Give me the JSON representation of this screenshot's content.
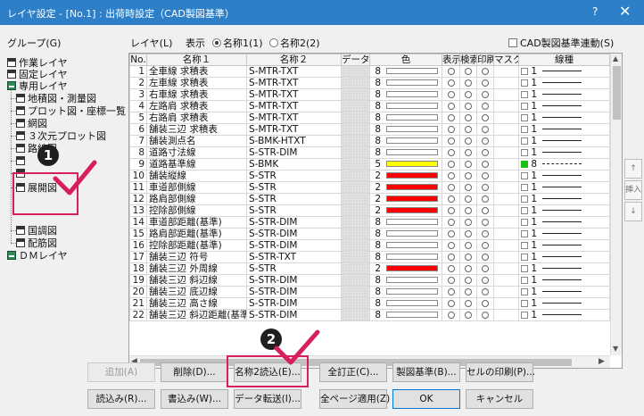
{
  "window": {
    "title": "レイヤ設定 - [No.1] : 出荷時設定（CAD製図基準）",
    "help": "?",
    "close": "✕"
  },
  "group_label": "グループ(G)",
  "layer_label": "レイヤ(L)",
  "display_label": "表示",
  "radio_name1": "名称1(1)",
  "radio_name2": "名称2(2)",
  "cad_checkbox": "CAD製図基準連動(S)",
  "tree": [
    {
      "label": "作業レイヤ",
      "icon": "layer-icon"
    },
    {
      "label": "固定レイヤ",
      "icon": "layer-icon"
    },
    {
      "label": "専用レイヤ",
      "icon": "folder-green-icon"
    },
    {
      "label": "地積図・測量図",
      "icon": "layer-icon"
    },
    {
      "label": "プロット図・座標一覧",
      "icon": "layer-icon"
    },
    {
      "label": "網図",
      "icon": "layer-icon"
    },
    {
      "label": "３次元プロット図",
      "icon": "layer-icon"
    },
    {
      "label": "路線図",
      "icon": "layer-icon"
    },
    {
      "label": "",
      "icon": "layer-icon"
    },
    {
      "label": "",
      "icon": "layer-icon"
    },
    {
      "label": "展開図",
      "icon": "layer-icon"
    },
    {
      "label": "国調図",
      "icon": "layer-icon"
    },
    {
      "label": "配筋図",
      "icon": "layer-icon"
    },
    {
      "label": "ＤＭレイヤ",
      "icon": "folder-green-icon"
    }
  ],
  "columns": [
    "No.",
    "名称１",
    "名称２",
    "データ",
    "色",
    "表示",
    "検索",
    "印刷",
    "マスク",
    "線種"
  ],
  "rows": [
    {
      "no": "1",
      "n1": "全車線 求積表",
      "n2": "S-MTR-TXT",
      "c": "8",
      "color": "#ffffff",
      "lc": "",
      "ln": "1",
      "line": "solid"
    },
    {
      "no": "2",
      "n1": "左車線 求積表",
      "n2": "S-MTR-TXT",
      "c": "8",
      "color": "#ffffff",
      "lc": "",
      "ln": "1",
      "line": "solid"
    },
    {
      "no": "3",
      "n1": "右車線 求積表",
      "n2": "S-MTR-TXT",
      "c": "8",
      "color": "#ffffff",
      "lc": "",
      "ln": "1",
      "line": "solid"
    },
    {
      "no": "4",
      "n1": "左路肩 求積表",
      "n2": "S-MTR-TXT",
      "c": "8",
      "color": "#ffffff",
      "lc": "",
      "ln": "1",
      "line": "solid"
    },
    {
      "no": "5",
      "n1": "右路肩 求積表",
      "n2": "S-MTR-TXT",
      "c": "8",
      "color": "#ffffff",
      "lc": "",
      "ln": "1",
      "line": "solid"
    },
    {
      "no": "6",
      "n1": "舗装三辺 求積表",
      "n2": "S-MTR-TXT",
      "c": "8",
      "color": "#ffffff",
      "lc": "",
      "ln": "1",
      "line": "solid"
    },
    {
      "no": "7",
      "n1": "舗装測点名",
      "n2": "S-BMK-HTXT",
      "c": "8",
      "color": "#ffffff",
      "lc": "",
      "ln": "1",
      "line": "solid"
    },
    {
      "no": "8",
      "n1": "道路寸法線",
      "n2": "S-STR-DIM",
      "c": "8",
      "color": "#ffffff",
      "lc": "",
      "ln": "1",
      "line": "solid"
    },
    {
      "no": "9",
      "n1": "道路基準線",
      "n2": "S-BMK",
      "c": "5",
      "color": "#ffff00",
      "lc": "green",
      "ln": "8",
      "line": "dash"
    },
    {
      "no": "10",
      "n1": "舗装縦線",
      "n2": "S-STR",
      "c": "2",
      "color": "#ff0000",
      "lc": "",
      "ln": "1",
      "line": "solid"
    },
    {
      "no": "11",
      "n1": "車道部側線",
      "n2": "S-STR",
      "c": "2",
      "color": "#ff0000",
      "lc": "",
      "ln": "1",
      "line": "solid"
    },
    {
      "no": "12",
      "n1": "路肩部側線",
      "n2": "S-STR",
      "c": "2",
      "color": "#ff0000",
      "lc": "",
      "ln": "1",
      "line": "solid"
    },
    {
      "no": "13",
      "n1": "控除部側線",
      "n2": "S-STR",
      "c": "2",
      "color": "#ff0000",
      "lc": "",
      "ln": "1",
      "line": "solid"
    },
    {
      "no": "14",
      "n1": "車道部距離(基準)",
      "n2": "S-STR-DIM",
      "c": "8",
      "color": "#ffffff",
      "lc": "",
      "ln": "1",
      "line": "solid"
    },
    {
      "no": "15",
      "n1": "路肩部距離(基準)",
      "n2": "S-STR-DIM",
      "c": "8",
      "color": "#ffffff",
      "lc": "",
      "ln": "1",
      "line": "solid"
    },
    {
      "no": "16",
      "n1": "控除部距離(基準)",
      "n2": "S-STR-DIM",
      "c": "8",
      "color": "#ffffff",
      "lc": "",
      "ln": "1",
      "line": "solid"
    },
    {
      "no": "17",
      "n1": "舗装三辺 符号",
      "n2": "S-STR-TXT",
      "c": "8",
      "color": "#ffffff",
      "lc": "",
      "ln": "1",
      "line": "solid"
    },
    {
      "no": "18",
      "n1": "舗装三辺 外周線",
      "n2": "S-STR",
      "c": "2",
      "color": "#ff0000",
      "lc": "",
      "ln": "1",
      "line": "solid"
    },
    {
      "no": "19",
      "n1": "舗装三辺 斜辺線",
      "n2": "S-STR-DIM",
      "c": "8",
      "color": "#ffffff",
      "lc": "",
      "ln": "1",
      "line": "solid"
    },
    {
      "no": "20",
      "n1": "舗装三辺 底辺線",
      "n2": "S-STR-DIM",
      "c": "8",
      "color": "#ffffff",
      "lc": "",
      "ln": "1",
      "line": "solid"
    },
    {
      "no": "21",
      "n1": "舗装三辺 高さ線",
      "n2": "S-STR-DIM",
      "c": "8",
      "color": "#ffffff",
      "lc": "",
      "ln": "1",
      "line": "solid"
    },
    {
      "no": "22",
      "n1": "舗装三辺 斜辺距離(基準)",
      "n2": "S-STR-DIM",
      "c": "8",
      "color": "#ffffff",
      "lc": "",
      "ln": "1",
      "line": "solid"
    }
  ],
  "side_buttons": {
    "up": "↑",
    "insert": "挿入",
    "down": "↓"
  },
  "buttons_row1": {
    "add": "追加(A)",
    "delete": "削除(D)...",
    "read_name2": "名称2読込(E)...",
    "correct_all": "全訂正(C)...",
    "drafting": "製図基準(B)...",
    "print_cell": "セルの印刷(P)..."
  },
  "buttons_row2": {
    "load": "読込み(R)...",
    "write": "書込み(W)...",
    "transfer": "データ転送(I)...",
    "apply_all": "全ページ適用(Z)",
    "ok": "OK",
    "cancel": "キャンセル"
  },
  "badges": {
    "one": "1",
    "two": "2"
  },
  "colors": {
    "titlebar": "#2d80c8",
    "highlight": "#d71f5b",
    "badge": "#1f1f1f"
  }
}
